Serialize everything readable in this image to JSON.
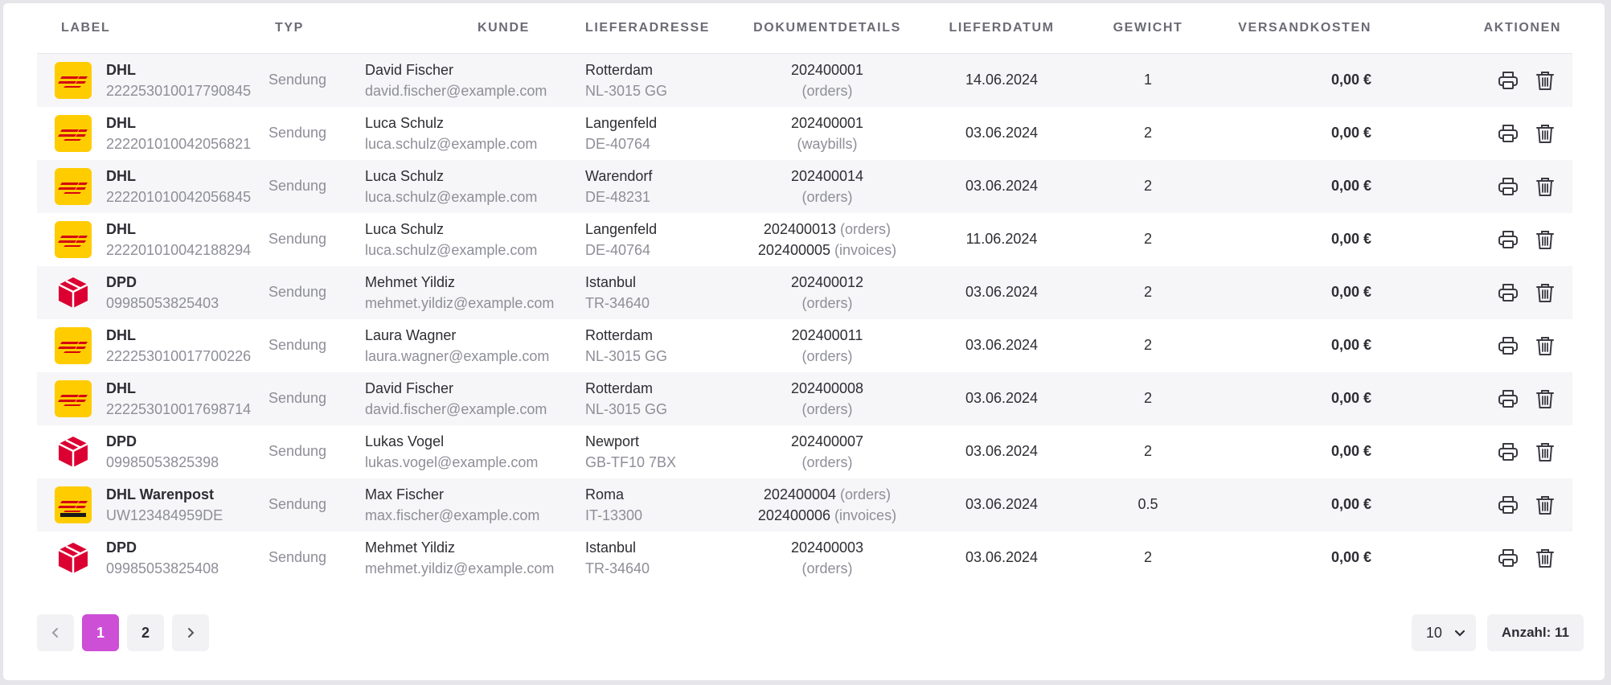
{
  "headers": {
    "label": "LABEL",
    "typ": "TYP",
    "kunde": "KUNDE",
    "lieferadresse": "LIEFERADRESSE",
    "dokumentdetails": "DOKUMENTDETAILS",
    "lieferdatum": "LIEFERDATUM",
    "gewicht": "GEWICHT",
    "versandkosten": "VERSANDKOSTEN",
    "aktionen": "AKTIONEN"
  },
  "rows": [
    {
      "carrier": "DHL",
      "tracking": "222253010017790845",
      "typ": "Sendung",
      "name": "David Fischer",
      "email": "david.fischer@example.com",
      "city": "Rotterdam",
      "zip": "NL-3015 GG",
      "doc1": "202400001",
      "doc1t": "(orders)",
      "doc2": "",
      "doc2t": "",
      "date": "14.06.2024",
      "weight": "1",
      "cost": "0,00 €"
    },
    {
      "carrier": "DHL",
      "tracking": "222201010042056821",
      "typ": "Sendung",
      "name": "Luca Schulz",
      "email": "luca.schulz@example.com",
      "city": "Langenfeld",
      "zip": "DE-40764",
      "doc1": "202400001",
      "doc1t": "(waybills)",
      "doc2": "",
      "doc2t": "",
      "date": "03.06.2024",
      "weight": "2",
      "cost": "0,00 €"
    },
    {
      "carrier": "DHL",
      "tracking": "222201010042056845",
      "typ": "Sendung",
      "name": "Luca Schulz",
      "email": "luca.schulz@example.com",
      "city": "Warendorf",
      "zip": "DE-48231",
      "doc1": "202400014",
      "doc1t": "(orders)",
      "doc2": "",
      "doc2t": "",
      "date": "03.06.2024",
      "weight": "2",
      "cost": "0,00 €"
    },
    {
      "carrier": "DHL",
      "tracking": "222201010042188294",
      "typ": "Sendung",
      "name": "Luca Schulz",
      "email": "luca.schulz@example.com",
      "city": "Langenfeld",
      "zip": "DE-40764",
      "doc1": "202400013",
      "doc1t": "(orders)",
      "doc2": "202400005",
      "doc2t": "(invoices)",
      "date": "11.06.2024",
      "weight": "2",
      "cost": "0,00 €"
    },
    {
      "carrier": "DPD",
      "tracking": "09985053825403",
      "typ": "Sendung",
      "name": "Mehmet Yildiz",
      "email": "mehmet.yildiz@example.com",
      "city": "Istanbul",
      "zip": "TR-34640",
      "doc1": "202400012",
      "doc1t": "(orders)",
      "doc2": "",
      "doc2t": "",
      "date": "03.06.2024",
      "weight": "2",
      "cost": "0,00 €"
    },
    {
      "carrier": "DHL",
      "tracking": "222253010017700226",
      "typ": "Sendung",
      "name": "Laura Wagner",
      "email": "laura.wagner@example.com",
      "city": "Rotterdam",
      "zip": "NL-3015 GG",
      "doc1": "202400011",
      "doc1t": "(orders)",
      "doc2": "",
      "doc2t": "",
      "date": "03.06.2024",
      "weight": "2",
      "cost": "0,00 €"
    },
    {
      "carrier": "DHL",
      "tracking": "222253010017698714",
      "typ": "Sendung",
      "name": "David Fischer",
      "email": "david.fischer@example.com",
      "city": "Rotterdam",
      "zip": "NL-3015 GG",
      "doc1": "202400008",
      "doc1t": "(orders)",
      "doc2": "",
      "doc2t": "",
      "date": "03.06.2024",
      "weight": "2",
      "cost": "0,00 €"
    },
    {
      "carrier": "DPD",
      "tracking": "09985053825398",
      "typ": "Sendung",
      "name": "Lukas Vogel",
      "email": "lukas.vogel@example.com",
      "city": "Newport",
      "zip": "GB-TF10 7BX",
      "doc1": "202400007",
      "doc1t": "(orders)",
      "doc2": "",
      "doc2t": "",
      "date": "03.06.2024",
      "weight": "2",
      "cost": "0,00 €"
    },
    {
      "carrier": "DHL Warenpost",
      "tracking": "UW123484959DE",
      "typ": "Sendung",
      "name": "Max Fischer",
      "email": "max.fischer@example.com",
      "city": "Roma",
      "zip": "IT-13300",
      "doc1": "202400004",
      "doc1t": "(orders)",
      "doc2": "202400006",
      "doc2t": "(invoices)",
      "date": "03.06.2024",
      "weight": "0.5",
      "cost": "0,00 €"
    },
    {
      "carrier": "DPD",
      "tracking": "09985053825408",
      "typ": "Sendung",
      "name": "Mehmet Yildiz",
      "email": "mehmet.yildiz@example.com",
      "city": "Istanbul",
      "zip": "TR-34640",
      "doc1": "202400003",
      "doc1t": "(orders)",
      "doc2": "",
      "doc2t": "",
      "date": "03.06.2024",
      "weight": "2",
      "cost": "0,00 €"
    }
  ],
  "logo_icons": [
    "dhl-logo-icon",
    "dhl-logo-icon",
    "dhl-logo-icon",
    "dhl-logo-icon",
    "dpd-logo-icon",
    "dhl-logo-icon",
    "dhl-logo-icon",
    "dpd-logo-icon",
    "dhl-warenpost-logo-icon",
    "dpd-logo-icon"
  ],
  "pagination": {
    "pages": [
      "1",
      "2"
    ],
    "current": "1"
  },
  "page_size": "10",
  "count_label": "Anzahl: 11",
  "colors": {
    "accent": "#cc4fd6",
    "dhl_yellow": "#ffcc00",
    "dhl_red": "#d40511",
    "dpd_red": "#dc0032"
  }
}
